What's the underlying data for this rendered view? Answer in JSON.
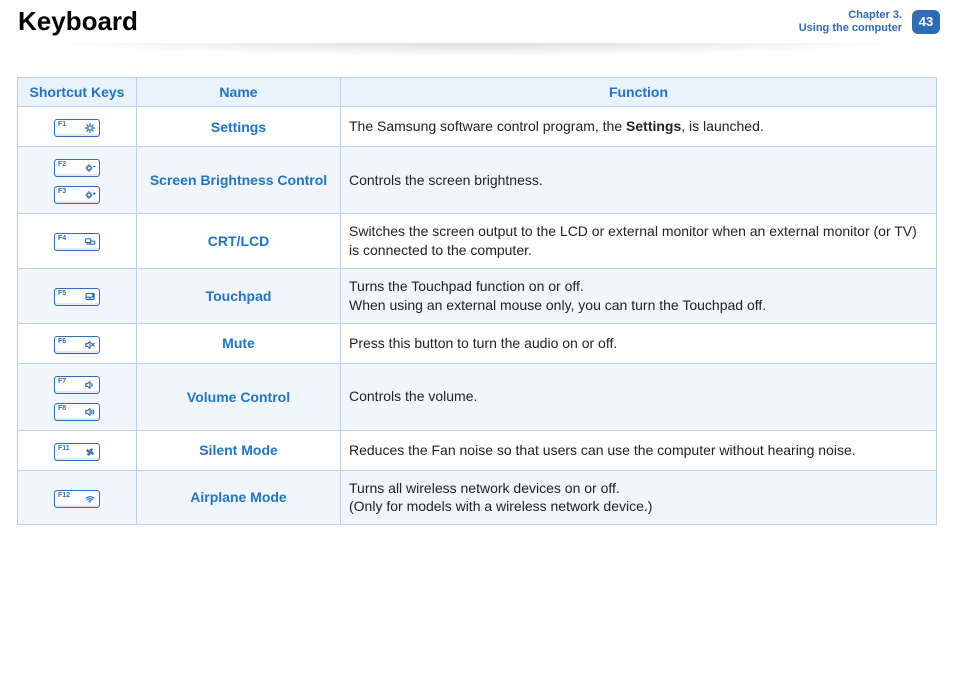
{
  "header": {
    "title": "Keyboard",
    "chapter_line1": "Chapter 3.",
    "chapter_line2": "Using the computer",
    "page_number": "43"
  },
  "columns": {
    "c1": "Shortcut Keys",
    "c2": "Name",
    "c3": "Function"
  },
  "rows": {
    "r1": {
      "keys": [
        {
          "label": "F1",
          "icon": "settings-icon"
        }
      ],
      "name": "Settings",
      "func_pre": "The Samsung software control program, the ",
      "func_bold": "Settings",
      "func_post": ", is launched."
    },
    "r2": {
      "keys": [
        {
          "label": "F2",
          "icon": "brightness-down-icon"
        },
        {
          "label": "F3",
          "icon": "brightness-up-icon"
        }
      ],
      "name": "Screen Brightness Control",
      "func": "Controls the screen brightness."
    },
    "r3": {
      "keys": [
        {
          "label": "F4",
          "icon": "display-switch-icon"
        }
      ],
      "name": "CRT/LCD",
      "func": "Switches the screen output to the LCD or external monitor when an external monitor (or TV) is connected to the computer."
    },
    "r4": {
      "keys": [
        {
          "label": "F5",
          "icon": "touchpad-icon"
        }
      ],
      "name": "Touchpad",
      "func_line1": "Turns the Touchpad function on or off.",
      "func_line2": "When using an external mouse only, you can turn the Touchpad off."
    },
    "r5": {
      "keys": [
        {
          "label": "F6",
          "icon": "mute-icon"
        }
      ],
      "name": "Mute",
      "func": "Press this button to turn the audio on or off."
    },
    "r6": {
      "keys": [
        {
          "label": "F7",
          "icon": "volume-down-icon"
        },
        {
          "label": "F8",
          "icon": "volume-up-icon"
        }
      ],
      "name": "Volume Control",
      "func": "Controls the volume."
    },
    "r7": {
      "keys": [
        {
          "label": "F11",
          "icon": "fan-icon"
        }
      ],
      "name": "Silent Mode",
      "func": "Reduces the Fan noise so that users can use the computer without hearing noise."
    },
    "r8": {
      "keys": [
        {
          "label": "F12",
          "icon": "wifi-icon"
        }
      ],
      "name": "Airplane Mode",
      "func_line1": "Turns all wireless network devices on or off.",
      "func_line2": "(Only for models with a wireless network device.)"
    }
  }
}
